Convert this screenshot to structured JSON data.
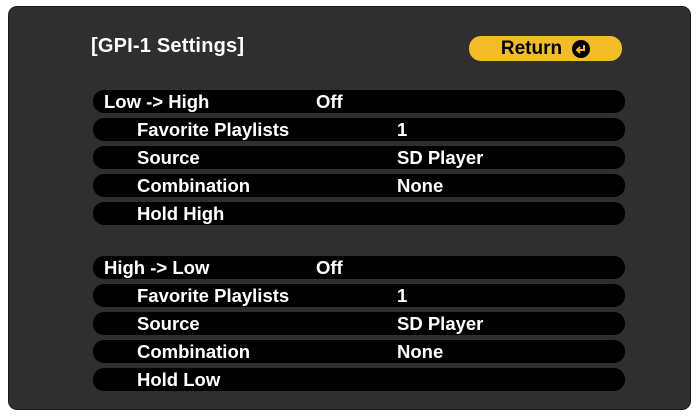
{
  "title": "[GPI-1 Settings]",
  "return_button": {
    "label": "Return",
    "icon": "enter-icon"
  },
  "sections": [
    {
      "header_label": "Low -> High",
      "header_value": "Off",
      "items": [
        {
          "label": "Favorite Playlists",
          "value": "1"
        },
        {
          "label": "Source",
          "value": "SD Player"
        },
        {
          "label": "Combination",
          "value": "None"
        },
        {
          "label": "Hold High",
          "value": ""
        }
      ]
    },
    {
      "header_label": "High -> Low",
      "header_value": "Off",
      "items": [
        {
          "label": "Favorite Playlists",
          "value": "1"
        },
        {
          "label": "Source",
          "value": "SD Player"
        },
        {
          "label": "Combination",
          "value": "None"
        },
        {
          "label": "Hold Low",
          "value": ""
        }
      ]
    }
  ],
  "colors": {
    "background": "#2f2f2f",
    "row": "#000000",
    "accent": "#f3bd2a",
    "text": "#ffffff"
  }
}
